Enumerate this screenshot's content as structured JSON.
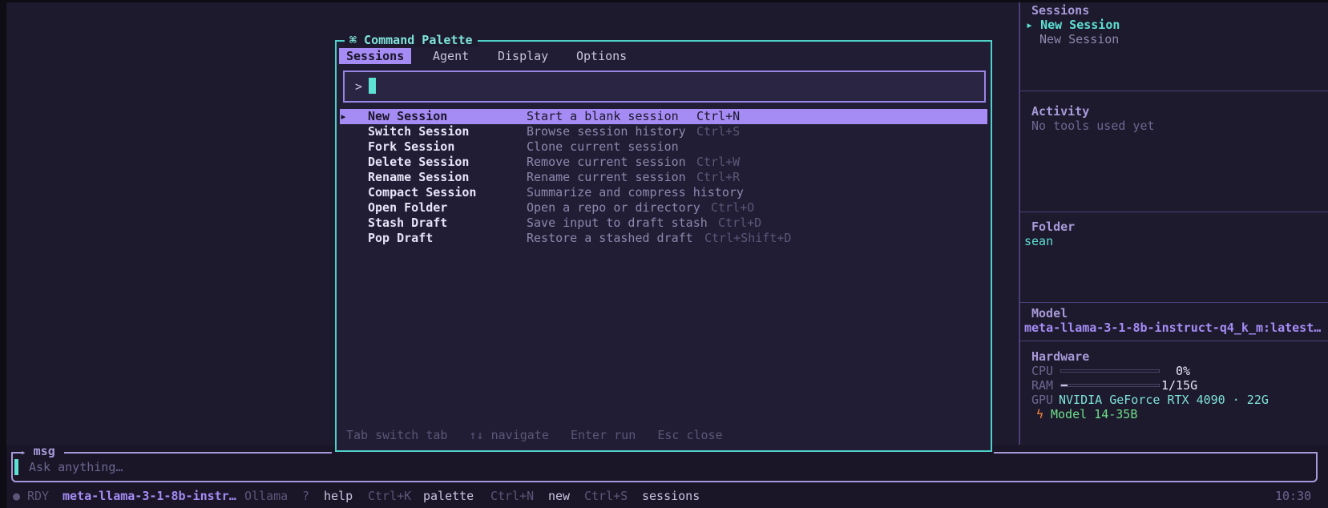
{
  "palette": {
    "title": "⌘ Command Palette",
    "tabs": [
      "Sessions",
      "Agent",
      "Display",
      "Options"
    ],
    "active_tab": "Sessions",
    "prompt": ">",
    "search_value": "",
    "commands": [
      {
        "name": "New Session",
        "desc": "Start a blank session",
        "shortcut": "Ctrl+N",
        "selected": true
      },
      {
        "name": "Switch Session",
        "desc": "Browse session history",
        "shortcut": "Ctrl+S"
      },
      {
        "name": "Fork Session",
        "desc": "Clone current session",
        "shortcut": ""
      },
      {
        "name": "Delete Session",
        "desc": "Remove current session",
        "shortcut": "Ctrl+W"
      },
      {
        "name": "Rename Session",
        "desc": "Rename current session",
        "shortcut": "Ctrl+R"
      },
      {
        "name": "Compact Session",
        "desc": "Summarize and compress history",
        "shortcut": ""
      },
      {
        "name": "Open Folder",
        "desc": "Open a repo or directory",
        "shortcut": "Ctrl+O"
      },
      {
        "name": "Stash Draft",
        "desc": "Save input to draft stash",
        "shortcut": "Ctrl+D"
      },
      {
        "name": "Pop Draft",
        "desc": "Restore a stashed draft",
        "shortcut": "Ctrl+Shift+D"
      }
    ],
    "hints": [
      {
        "key": "Tab",
        "label": "switch tab"
      },
      {
        "key": "↑↓",
        "label": "navigate"
      },
      {
        "key": "Enter",
        "label": "run"
      },
      {
        "key": "Esc",
        "label": "close"
      }
    ]
  },
  "sidebar": {
    "sessions_title": "Sessions",
    "sessions": [
      {
        "label": "New Session",
        "active": true
      },
      {
        "label": "New Session",
        "active": false
      }
    ],
    "activity_title": "Activity",
    "activity_text": "No tools used yet",
    "folder_title": "Folder",
    "folder_value": "sean",
    "model_title": "Model",
    "model_value": "meta-llama-3-1-8b-instruct-q4_k_m:latest…",
    "hardware_title": "Hardware",
    "cpu_label": "CPU",
    "cpu_value": "0%",
    "cpu_fraction": 0,
    "ram_label": "RAM",
    "ram_value": "1/15G",
    "ram_fraction": 0.067,
    "gpu_label": "GPU",
    "gpu_value": "NVIDIA GeForce RTX 4090 · 22G",
    "model_fit": "Model 14-35B"
  },
  "input": {
    "label": "msg",
    "placeholder": "Ask anything…"
  },
  "status": {
    "state": "RDY",
    "model": "meta-llama-3-1-8b-instr…",
    "provider": "Ollama",
    "items": [
      {
        "key": "?",
        "label": "help"
      },
      {
        "key": "Ctrl+K",
        "label": "palette"
      },
      {
        "key": "Ctrl+N",
        "label": "new"
      },
      {
        "key": "Ctrl+S",
        "label": "sessions"
      }
    ],
    "time": "10:30"
  },
  "colors": {
    "accent": "#a58cf5",
    "teal": "#4fd0c8",
    "background": "#1d1a2e"
  }
}
